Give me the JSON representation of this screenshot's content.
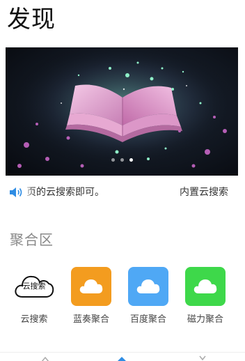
{
  "page": {
    "title": "发现"
  },
  "banner": {
    "image_name": "magic-book-banner",
    "dots": 3,
    "active_dot": 2
  },
  "ticker": {
    "icon": "speaker-icon",
    "text_1": "页的云搜索即可。",
    "text_2": "内置云搜索"
  },
  "section": {
    "title": "聚合区"
  },
  "apps": [
    {
      "label": "云搜索",
      "icon": "cloud-search-icon",
      "icon_text": "云搜索",
      "color": "#ffffff"
    },
    {
      "label": "蓝奏聚合",
      "icon": "cloud-icon",
      "color": "#F39C1F"
    },
    {
      "label": "百度聚合",
      "icon": "cloud-icon",
      "color": "#4FA8F5"
    },
    {
      "label": "磁力聚合",
      "icon": "cloud-icon",
      "color": "#3ED84A"
    }
  ],
  "colors": {
    "accent": "#2F8DE4",
    "title": "#111111",
    "section": "#888888"
  }
}
